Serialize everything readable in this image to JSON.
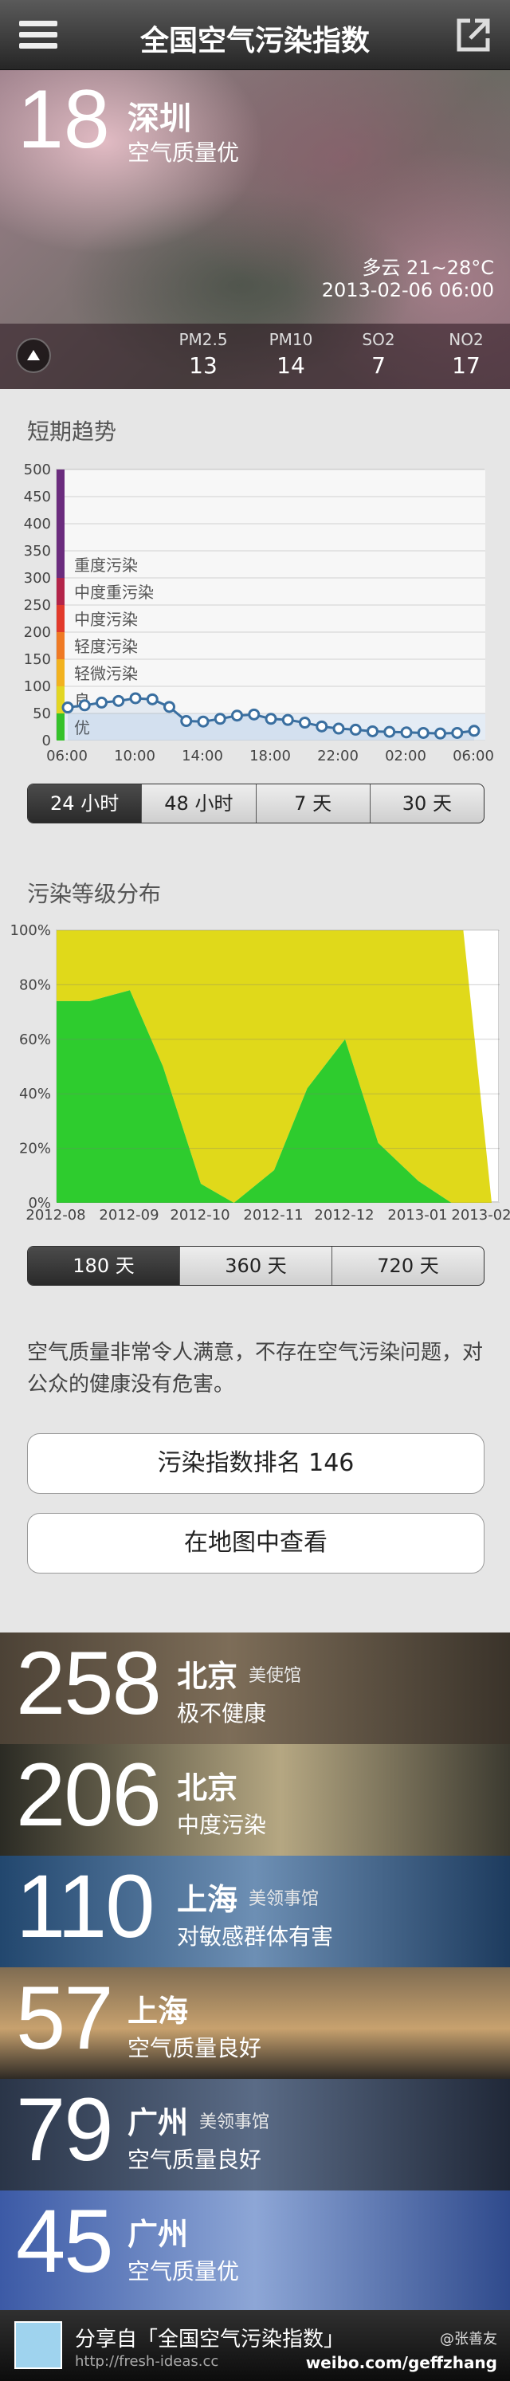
{
  "navbar": {
    "title": "全国空气污染指数"
  },
  "hero": {
    "aqi": "18",
    "city": "深圳",
    "quality": "空气质量优",
    "weather": "多云 21~28°C",
    "datetime": "2013-02-06 06:00",
    "pollutants": [
      {
        "name": "PM2.5",
        "value": "13"
      },
      {
        "name": "PM10",
        "value": "14"
      },
      {
        "name": "SO2",
        "value": "7"
      },
      {
        "name": "NO2",
        "value": "17"
      }
    ]
  },
  "trend": {
    "title": "短期趋势",
    "ranges": [
      "24 小时",
      "48 小时",
      "7 天",
      "30 天"
    ],
    "active_range": 0
  },
  "distribution": {
    "title": "污染等级分布",
    "ranges": [
      "180 天",
      "360 天",
      "720 天"
    ],
    "active_range": 0
  },
  "chart_data": [
    {
      "type": "line",
      "x": [
        "06:00",
        "07:00",
        "08:00",
        "09:00",
        "10:00",
        "11:00",
        "12:00",
        "13:00",
        "14:00",
        "15:00",
        "16:00",
        "17:00",
        "18:00",
        "19:00",
        "20:00",
        "21:00",
        "22:00",
        "23:00",
        "00:00",
        "01:00",
        "02:00",
        "03:00",
        "04:00",
        "05:00",
        "06:00"
      ],
      "tick_labels": [
        "06:00",
        "10:00",
        "14:00",
        "18:00",
        "22:00",
        "02:00",
        "06:00"
      ],
      "values": [
        61,
        65,
        70,
        73,
        78,
        76,
        62,
        36,
        35,
        40,
        46,
        48,
        40,
        38,
        33,
        26,
        22,
        20,
        17,
        16,
        15,
        14,
        13,
        14,
        18
      ],
      "ylim": [
        0,
        500
      ],
      "yticks": [
        0,
        50,
        100,
        150,
        200,
        250,
        300,
        350,
        400,
        450,
        500
      ],
      "bands": [
        {
          "label": "优",
          "from": 0,
          "to": 50,
          "color": "#35c22a"
        },
        {
          "label": "良",
          "from": 50,
          "to": 100,
          "color": "#e3d623"
        },
        {
          "label": "轻微污染",
          "from": 100,
          "to": 150,
          "color": "#f2b21f"
        },
        {
          "label": "轻度污染",
          "from": 150,
          "to": 200,
          "color": "#ef7a24"
        },
        {
          "label": "中度污染",
          "from": 200,
          "to": 250,
          "color": "#e23a2b"
        },
        {
          "label": "中度重污染",
          "from": 250,
          "to": 300,
          "color": "#b32449"
        },
        {
          "label": "重度污染",
          "from": 300,
          "to": 500,
          "color": "#6b2c7e"
        }
      ],
      "line_color": "#3a6fa0",
      "grid": true
    },
    {
      "type": "area",
      "x": [
        "2012-08-01",
        "2012-08-15",
        "2012-09-01",
        "2012-09-15",
        "2012-10-01",
        "2012-10-15",
        "2012-11-01",
        "2012-11-15",
        "2012-12-01",
        "2012-12-15",
        "2013-01-01",
        "2013-01-15",
        "2013-01-20",
        "2013-02-01"
      ],
      "tick_labels": [
        "2012-08",
        "2012-09",
        "2012-10",
        "2012-11",
        "2012-12",
        "2013-01",
        "2013-02"
      ],
      "series": [
        {
          "name": "优",
          "color": "#2ecc2e",
          "values": [
            74,
            74,
            78,
            50,
            7,
            0,
            12,
            42,
            60,
            22,
            8,
            0,
            0,
            0
          ]
        },
        {
          "name": "良",
          "color": "#e0d91a",
          "values": [
            26,
            26,
            22,
            50,
            93,
            100,
            88,
            58,
            40,
            78,
            92,
            100,
            100,
            0
          ]
        }
      ],
      "ylim": [
        0,
        100
      ],
      "yticks": [
        "0%",
        "20%",
        "40%",
        "60%",
        "80%",
        "100%"
      ],
      "grid": true
    }
  ],
  "description": "空气质量非常令人满意，不存在空气污染问题，对公众的健康没有危害。",
  "buttons": {
    "rank": "污染指数排名 146",
    "map": "在地图中查看"
  },
  "cities": [
    {
      "aqi": "258",
      "city": "北京",
      "station": "美使馆",
      "level": "极不健康"
    },
    {
      "aqi": "206",
      "city": "北京",
      "station": "",
      "level": "中度污染"
    },
    {
      "aqi": "110",
      "city": "上海",
      "station": "美领事馆",
      "level": "对敏感群体有害"
    },
    {
      "aqi": "57",
      "city": "上海",
      "station": "",
      "level": "空气质量良好"
    },
    {
      "aqi": "79",
      "city": "广州",
      "station": "美领事馆",
      "level": "空气质量良好"
    },
    {
      "aqi": "45",
      "city": "广州",
      "station": "",
      "level": "空气质量优"
    }
  ],
  "footer": {
    "title": "分享自「全国空气污染指数」",
    "url": "http://fresh-ideas.cc",
    "user": "@张善友",
    "weibo": "weibo.com/geffzhang"
  },
  "icons": {
    "menu": "menu-icon",
    "share": "share-icon",
    "toggle": "triangle-up-icon",
    "weibo": "weibo-icon"
  }
}
